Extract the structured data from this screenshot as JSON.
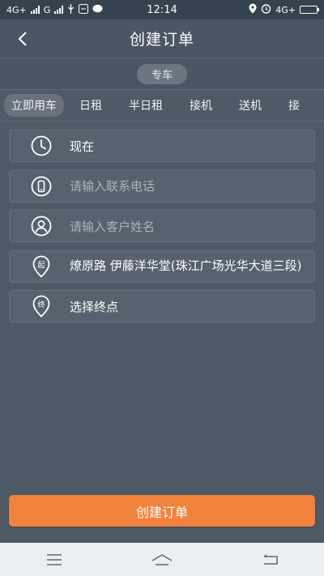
{
  "status_bar": {
    "network_left": "4G+",
    "network_mid": "G",
    "time": "12:14",
    "network_right": "4G+"
  },
  "header": {
    "title": "创建订单"
  },
  "service_type": "专车",
  "tabs": [
    "立即用车",
    "日租",
    "半日租",
    "接机",
    "送机",
    "接"
  ],
  "form": {
    "time_value": "现在",
    "phone_placeholder": "请输入联系电话",
    "name_placeholder": "请输入客户姓名",
    "start_badge": "起",
    "start_address": "燎原路  伊藤洋华堂(珠江广场光华大道三段)",
    "end_badge": "终",
    "end_placeholder": "选择终点"
  },
  "submit_label": "创建订单",
  "colors": {
    "background": "#4d5a66",
    "accent": "#f1823b"
  }
}
